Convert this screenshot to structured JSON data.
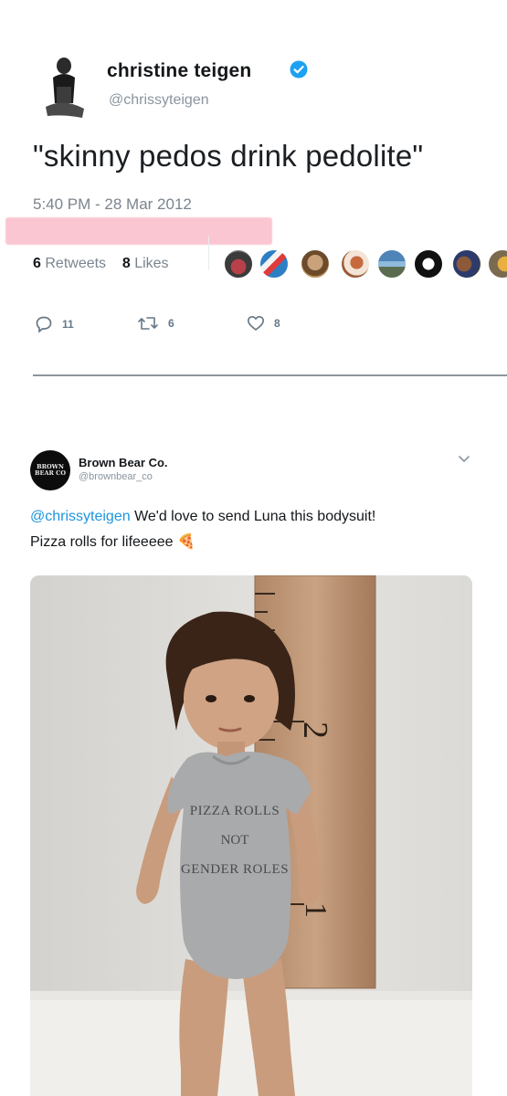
{
  "tweet1": {
    "name": "christine teigen",
    "handle": "@chrissyteigen",
    "text": "\"skinny pedos drink pedolite\"",
    "timestamp": "5:40 PM - 28 Mar 2012",
    "retweets_count": "6",
    "retweets_label": "Retweets",
    "likes_count": "8",
    "likes_label": "Likes",
    "reply_count": "11",
    "retweet_action_count": "6",
    "like_action_count": "8",
    "highlight_color": "#f6a0b4",
    "verified_color": "#1da1f2"
  },
  "tweet2": {
    "name": "Brown Bear Co.",
    "handle": "@brownbear_co",
    "avatar_text": "BROWN BEAR CO",
    "mention": "@chrissyteigen",
    "text_line1": " We'd love to send Luna this bodysuit!",
    "text_line2": "Pizza rolls for lifeeeee ",
    "emoji": "🍕"
  },
  "photo": {
    "shirt_line1": "PIZZA ROLLS",
    "shirt_line2": "NOT",
    "shirt_line3": "GENDER ROLES",
    "ruler_mark_2": "2",
    "ruler_mark_1": "1"
  },
  "icons": {
    "reply": "reply-icon",
    "retweet": "retweet-icon",
    "like": "heart-icon",
    "more": "chevron-down-icon",
    "verified": "verified-badge-icon"
  }
}
